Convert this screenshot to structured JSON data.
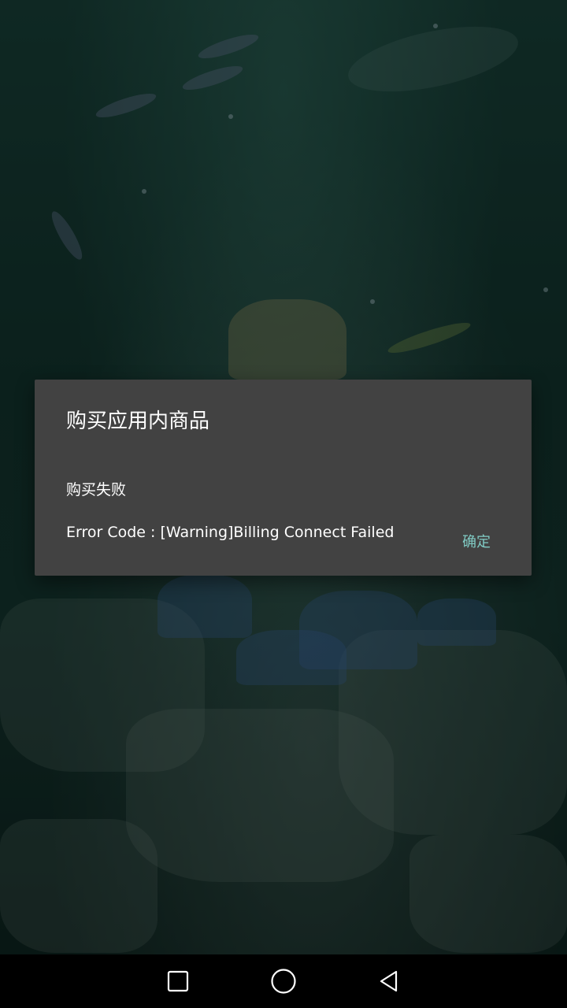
{
  "dialog": {
    "title": "购买应用内商品",
    "message_line1": "购买失败",
    "message_line2": "Error Code : [Warning]Billing Connect Failed",
    "confirm_label": "确定"
  },
  "colors": {
    "dialog_bg": "#424242",
    "accent": "#80cbc4",
    "navbar_bg": "#000000"
  },
  "navbar": {
    "icons": [
      "recents-square-icon",
      "home-circle-icon",
      "back-triangle-icon"
    ]
  }
}
